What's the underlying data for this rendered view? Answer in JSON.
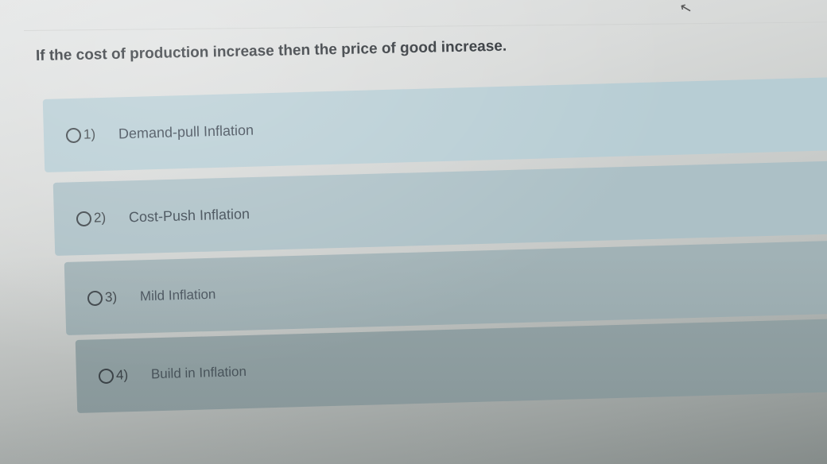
{
  "question": "If the cost of production increase then the price of good increase.",
  "options": [
    {
      "number": "1)",
      "label": "Demand-pull Inflation"
    },
    {
      "number": "2)",
      "label": "Cost-Push Inflation"
    },
    {
      "number": "3)",
      "label": "Mild Inflation"
    },
    {
      "number": "4)",
      "label": "Build in Inflation"
    }
  ],
  "cursor_icon": "mouse-pointer-icon",
  "colors": {
    "option_bg": "#b7cdd4",
    "text": "#2c3136"
  }
}
